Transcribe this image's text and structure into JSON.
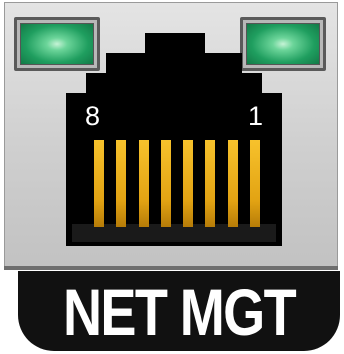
{
  "port": {
    "label": "NET MGT",
    "pin_left": "8",
    "pin_right": "1",
    "pin_count": 8,
    "colors": {
      "led": "#1f9e5f",
      "pins": "#e8a817",
      "label_bg": "#111111",
      "label_text": "#ffffff"
    }
  }
}
